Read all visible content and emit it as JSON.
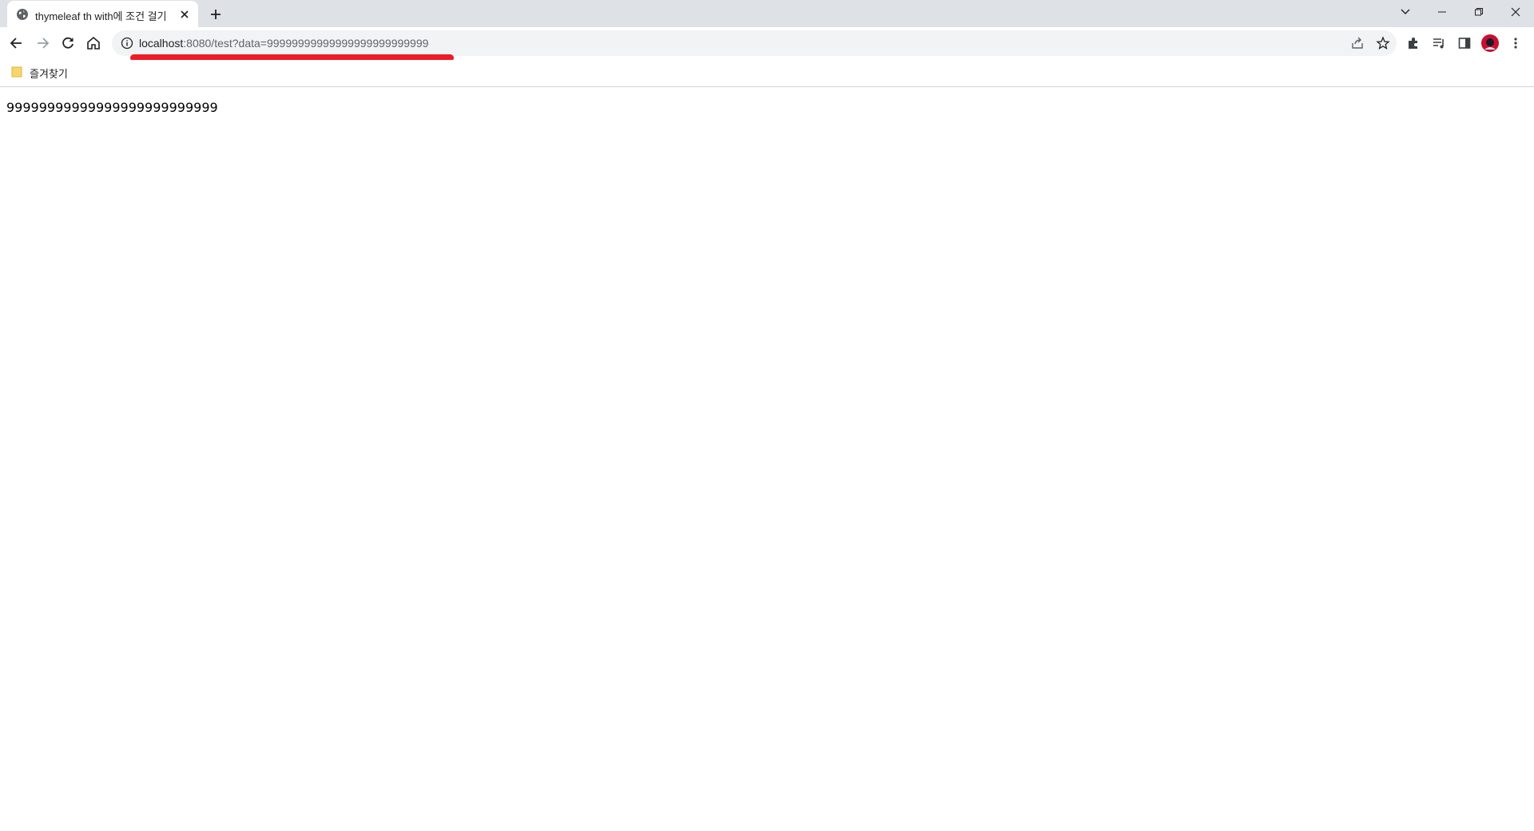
{
  "tab": {
    "title": "thymeleaf th with에 조건 걸기",
    "favicon": "globe-icon",
    "close_icon": "close-icon",
    "new_tab_icon": "plus-icon"
  },
  "window_controls": [
    "tab-search-icon",
    "minimize-icon",
    "restore-icon",
    "close-icon"
  ],
  "toolbar": {
    "icons": [
      "back-arrow-icon",
      "forward-arrow-icon",
      "reload-icon",
      "home-icon"
    ],
    "omnibox": {
      "security_icon": "info-icon",
      "url_host": "localhost",
      "url_rest": ":8080/test?data=99999999999999999999999999",
      "right_icons": [
        "share-icon",
        "star-icon"
      ]
    },
    "right_icons": [
      "extensions-icon",
      "media-queue-icon",
      "side-panel-icon",
      "avatar",
      "menu-dots-icon"
    ]
  },
  "bookmarks": {
    "items": [
      {
        "label": "즐겨찾기",
        "icon": "folder-icon"
      }
    ]
  },
  "page": {
    "body_text": "99999999999999999999999999"
  },
  "colors": {
    "tabstrip_bg": "#dee1e6",
    "omnibox_bg": "#f1f3f4",
    "annotation_underline": "#ee1c25",
    "avatar": "#c8102e",
    "folder": "#f9d66b"
  }
}
